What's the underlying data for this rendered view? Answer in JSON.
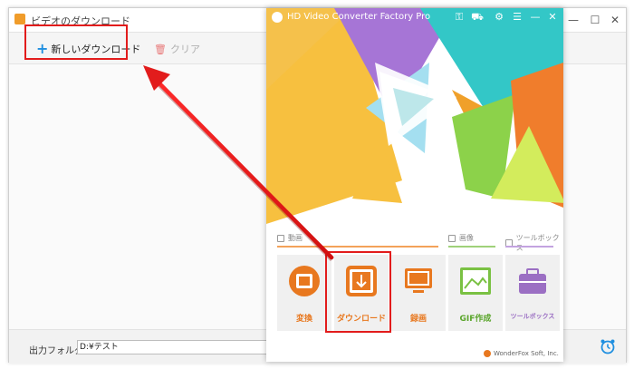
{
  "back_window": {
    "title": "ビデオのダウンロード",
    "new_download_label": "新しいダウンロード",
    "clear_label": "クリア",
    "output_folder_label": "出力フォルダ：",
    "output_folder_value": "D:¥テスト"
  },
  "main_window": {
    "app_name": "HD Video Converter Factory Pro",
    "sections": {
      "video": "動画",
      "image": "画像",
      "toolbox": "ツールボックス"
    },
    "cards": [
      {
        "id": "convert",
        "label": "変換",
        "icon": "convert-icon"
      },
      {
        "id": "download",
        "label": "ダウンロード",
        "icon": "download-icon"
      },
      {
        "id": "record",
        "label": "録画",
        "icon": "record-icon"
      },
      {
        "id": "gif",
        "label": "GIF作成",
        "icon": "image-icon"
      },
      {
        "id": "toolbox",
        "label": "ツールボックス",
        "icon": "toolbox-icon"
      }
    ],
    "footer": "WonderFox Soft, Inc."
  },
  "colors": {
    "highlight": "#e21c1c",
    "accent_orange": "#e8781f",
    "toolbox_purple": "#9b6fc3",
    "gif_green": "#7ac143"
  }
}
